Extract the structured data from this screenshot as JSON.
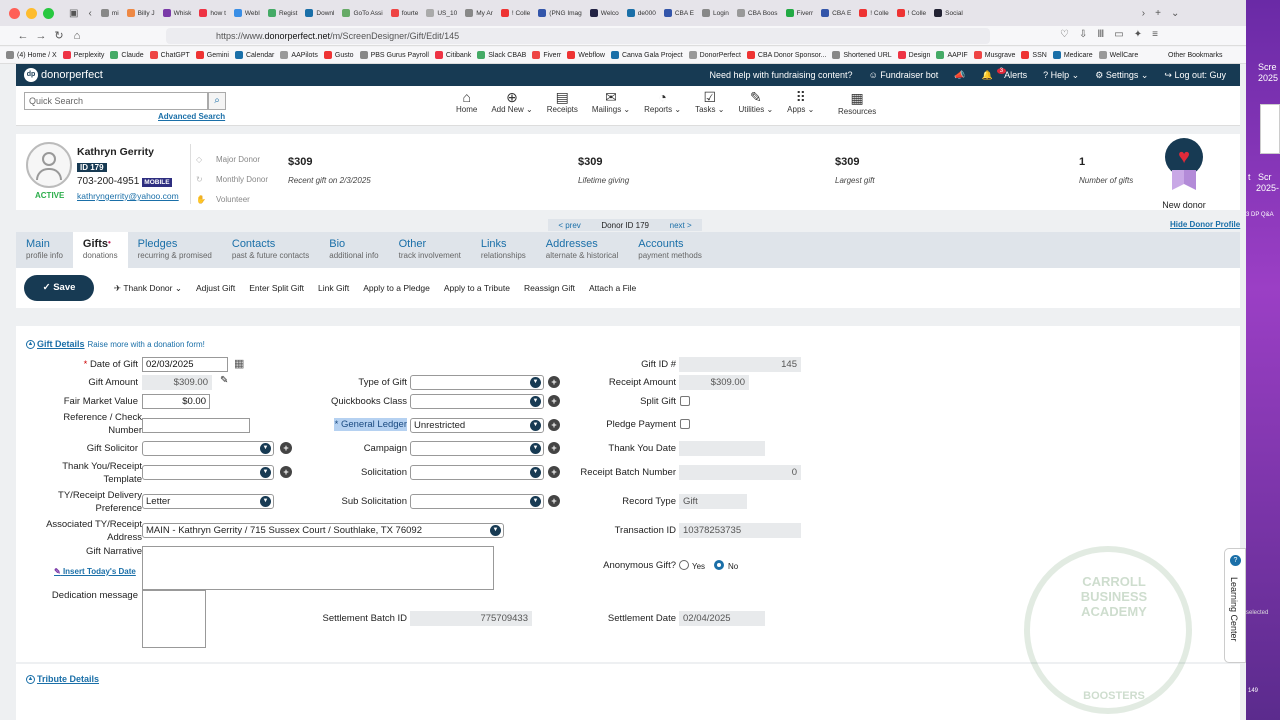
{
  "browser": {
    "tabs": [
      "mi",
      "Billy J",
      "Whisk",
      "how t",
      "Edi",
      "WebI",
      "Regist",
      "Downl",
      "GoTo Assi",
      "fourte",
      "US_10",
      "My Ar",
      "! Colle",
      "(PNG Imag",
      "Welco",
      "de000",
      "CBA E",
      "Login",
      "CBA Boos",
      "Fiverr",
      "CBA E",
      "! Colle",
      "! Colle",
      "Social"
    ],
    "active_tab": "Edi",
    "url_prefix": "https://www.",
    "url_domain": "donorperfect.net",
    "url_path": "/m/ScreenDesigner/Gift/Edit/145",
    "bookmarks": [
      "(4) Home / X",
      "Perplexity",
      "Claude",
      "ChatGPT",
      "Gemini",
      "Calendar",
      "AAPilots",
      "Gusto",
      "PBS Gurus Payroll",
      "Citibank",
      "Slack CBAB",
      "Fiverr",
      "Webflow",
      "Canva Gala Project",
      "DonorPerfect",
      "CBA Donor Sponsor...",
      "Shortened URL",
      "Design",
      "AAPIF",
      "Musgrave",
      "SSN",
      "Medicare",
      "WellCare"
    ],
    "other_bookmarks": "Other Bookmarks"
  },
  "right_strip": {
    "texts": [
      "Scre",
      "2025",
      "t",
      "Scr",
      "2025-",
      "3 DP Q&A",
      "selected",
      "149"
    ]
  },
  "topbar": {
    "logo": "donorperfect",
    "help_prompt": "Need help with fundraising content?",
    "bot": "Fundraiser bot",
    "alerts": "Alerts",
    "alerts_count": "3",
    "help": "Help",
    "settings": "Settings",
    "logout": "Log out: Guy"
  },
  "search": {
    "placeholder": "Quick Search",
    "advanced": "Advanced Search"
  },
  "mainnav": [
    {
      "icon": "home-icon",
      "glyph": "⌂",
      "label": "Home"
    },
    {
      "icon": "add-icon",
      "glyph": "⊕",
      "label": "Add New ⌄"
    },
    {
      "icon": "receipt-icon",
      "glyph": "▤",
      "label": "Receipts"
    },
    {
      "icon": "mail-icon",
      "glyph": "✉",
      "label": "Mailings ⌄"
    },
    {
      "icon": "pie-icon",
      "glyph": "◔",
      "label": "Reports ⌄"
    },
    {
      "icon": "tasks-icon",
      "glyph": "☑",
      "label": "Tasks ⌄"
    },
    {
      "icon": "wrench-icon",
      "glyph": "✎",
      "label": "Utilities ⌄"
    },
    {
      "icon": "apps-icon",
      "glyph": "⠿",
      "label": "Apps ⌄"
    }
  ],
  "resources": {
    "label": "Resources"
  },
  "donor": {
    "name": "Kathryn Gerrity",
    "id": "ID 179",
    "phone": "703-200-4951",
    "phone_type": "MOBILE",
    "email": "kathryngerrity@yahoo.com",
    "status": "ACTIVE",
    "tags": [
      "Major Donor",
      "Monthly Donor",
      "Volunteer"
    ],
    "stats": [
      {
        "value": "$309",
        "label": "Recent gift on 2/3/2025"
      },
      {
        "value": "$309",
        "label": "Lifetime giving"
      },
      {
        "value": "$309",
        "label": "Largest gift"
      },
      {
        "value": "1",
        "label": "Number of gifts"
      }
    ],
    "badge": "New donor"
  },
  "pager": {
    "prev": "< prev",
    "label": "Donor ID",
    "id": "179",
    "next": "next >"
  },
  "hide_profile": "Hide Donor Profile",
  "tabs": [
    {
      "title": "Main",
      "sub": "profile info"
    },
    {
      "title": "Gifts",
      "sub": "donations"
    },
    {
      "title": "Pledges",
      "sub": "recurring & promised"
    },
    {
      "title": "Contacts",
      "sub": "past & future contacts"
    },
    {
      "title": "Bio",
      "sub": "additional info"
    },
    {
      "title": "Other",
      "sub": "track involvement"
    },
    {
      "title": "Links",
      "sub": "relationships"
    },
    {
      "title": "Addresses",
      "sub": "alternate & historical"
    },
    {
      "title": "Accounts",
      "sub": "payment methods"
    }
  ],
  "actions": {
    "save": "Save",
    "items": [
      "Thank Donor ⌄",
      "Adjust Gift",
      "Enter Split Gift",
      "Link Gift",
      "Apply to a Pledge",
      "Apply to a Tribute",
      "Reassign Gift",
      "Attach a File"
    ]
  },
  "gift": {
    "section_title": "Gift Details",
    "section_link": "Raise more with a donation form!",
    "date_label": "Date of Gift",
    "date": "02/03/2025",
    "amount_label": "Gift Amount",
    "amount": "$309.00",
    "fmv_label": "Fair Market Value",
    "fmv": "$0.00",
    "ref_label": "Reference / Check Number",
    "ref": "",
    "solicitor_label": "Gift Solicitor",
    "tyr_template_label": "Thank You/Receipt Template",
    "tyr_delivery_label": "TY/Receipt Delivery Preference",
    "tyr_delivery": "Letter",
    "assoc_label": "Associated TY/Receipt Address",
    "assoc": "MAIN - Kathryn Gerrity / 715 Sussex Court / Southlake, TX 76092",
    "narrative_label": "Gift Narrative",
    "insert_date": "Insert Today's Date",
    "dedication_label": "Dedication message",
    "type_label": "Type of Gift",
    "qb_label": "Quickbooks Class",
    "gl_label": "General Ledger",
    "gl": "Unrestricted",
    "campaign_label": "Campaign",
    "solicitation_label": "Solicitation",
    "subsolicitation_label": "Sub Solicitation",
    "settlement_batch_label": "Settlement Batch ID",
    "settlement_batch": "775709433",
    "giftid_label": "Gift ID #",
    "giftid": "145",
    "receipt_amount_label": "Receipt Amount",
    "receipt_amount": "$309.00",
    "split_label": "Split Gift",
    "pledge_label": "Pledge Payment",
    "tydate_label": "Thank You Date",
    "tydate": "",
    "batch_label": "Receipt Batch Number",
    "batch": "0",
    "record_type_label": "Record Type",
    "record_type": "Gift",
    "transaction_label": "Transaction ID",
    "transaction": "10378253735",
    "anon_label": "Anonymous Gift?",
    "anon_yes": "Yes",
    "anon_no": "No",
    "settlement_date_label": "Settlement Date",
    "settlement_date": "02/04/2025"
  },
  "tribute": {
    "section_title": "Tribute Details"
  },
  "learning_center": "Learning Center",
  "watermark": {
    "top": "CARROLL BUSINESS ACADEMY",
    "bottom": "BOOSTERS"
  }
}
